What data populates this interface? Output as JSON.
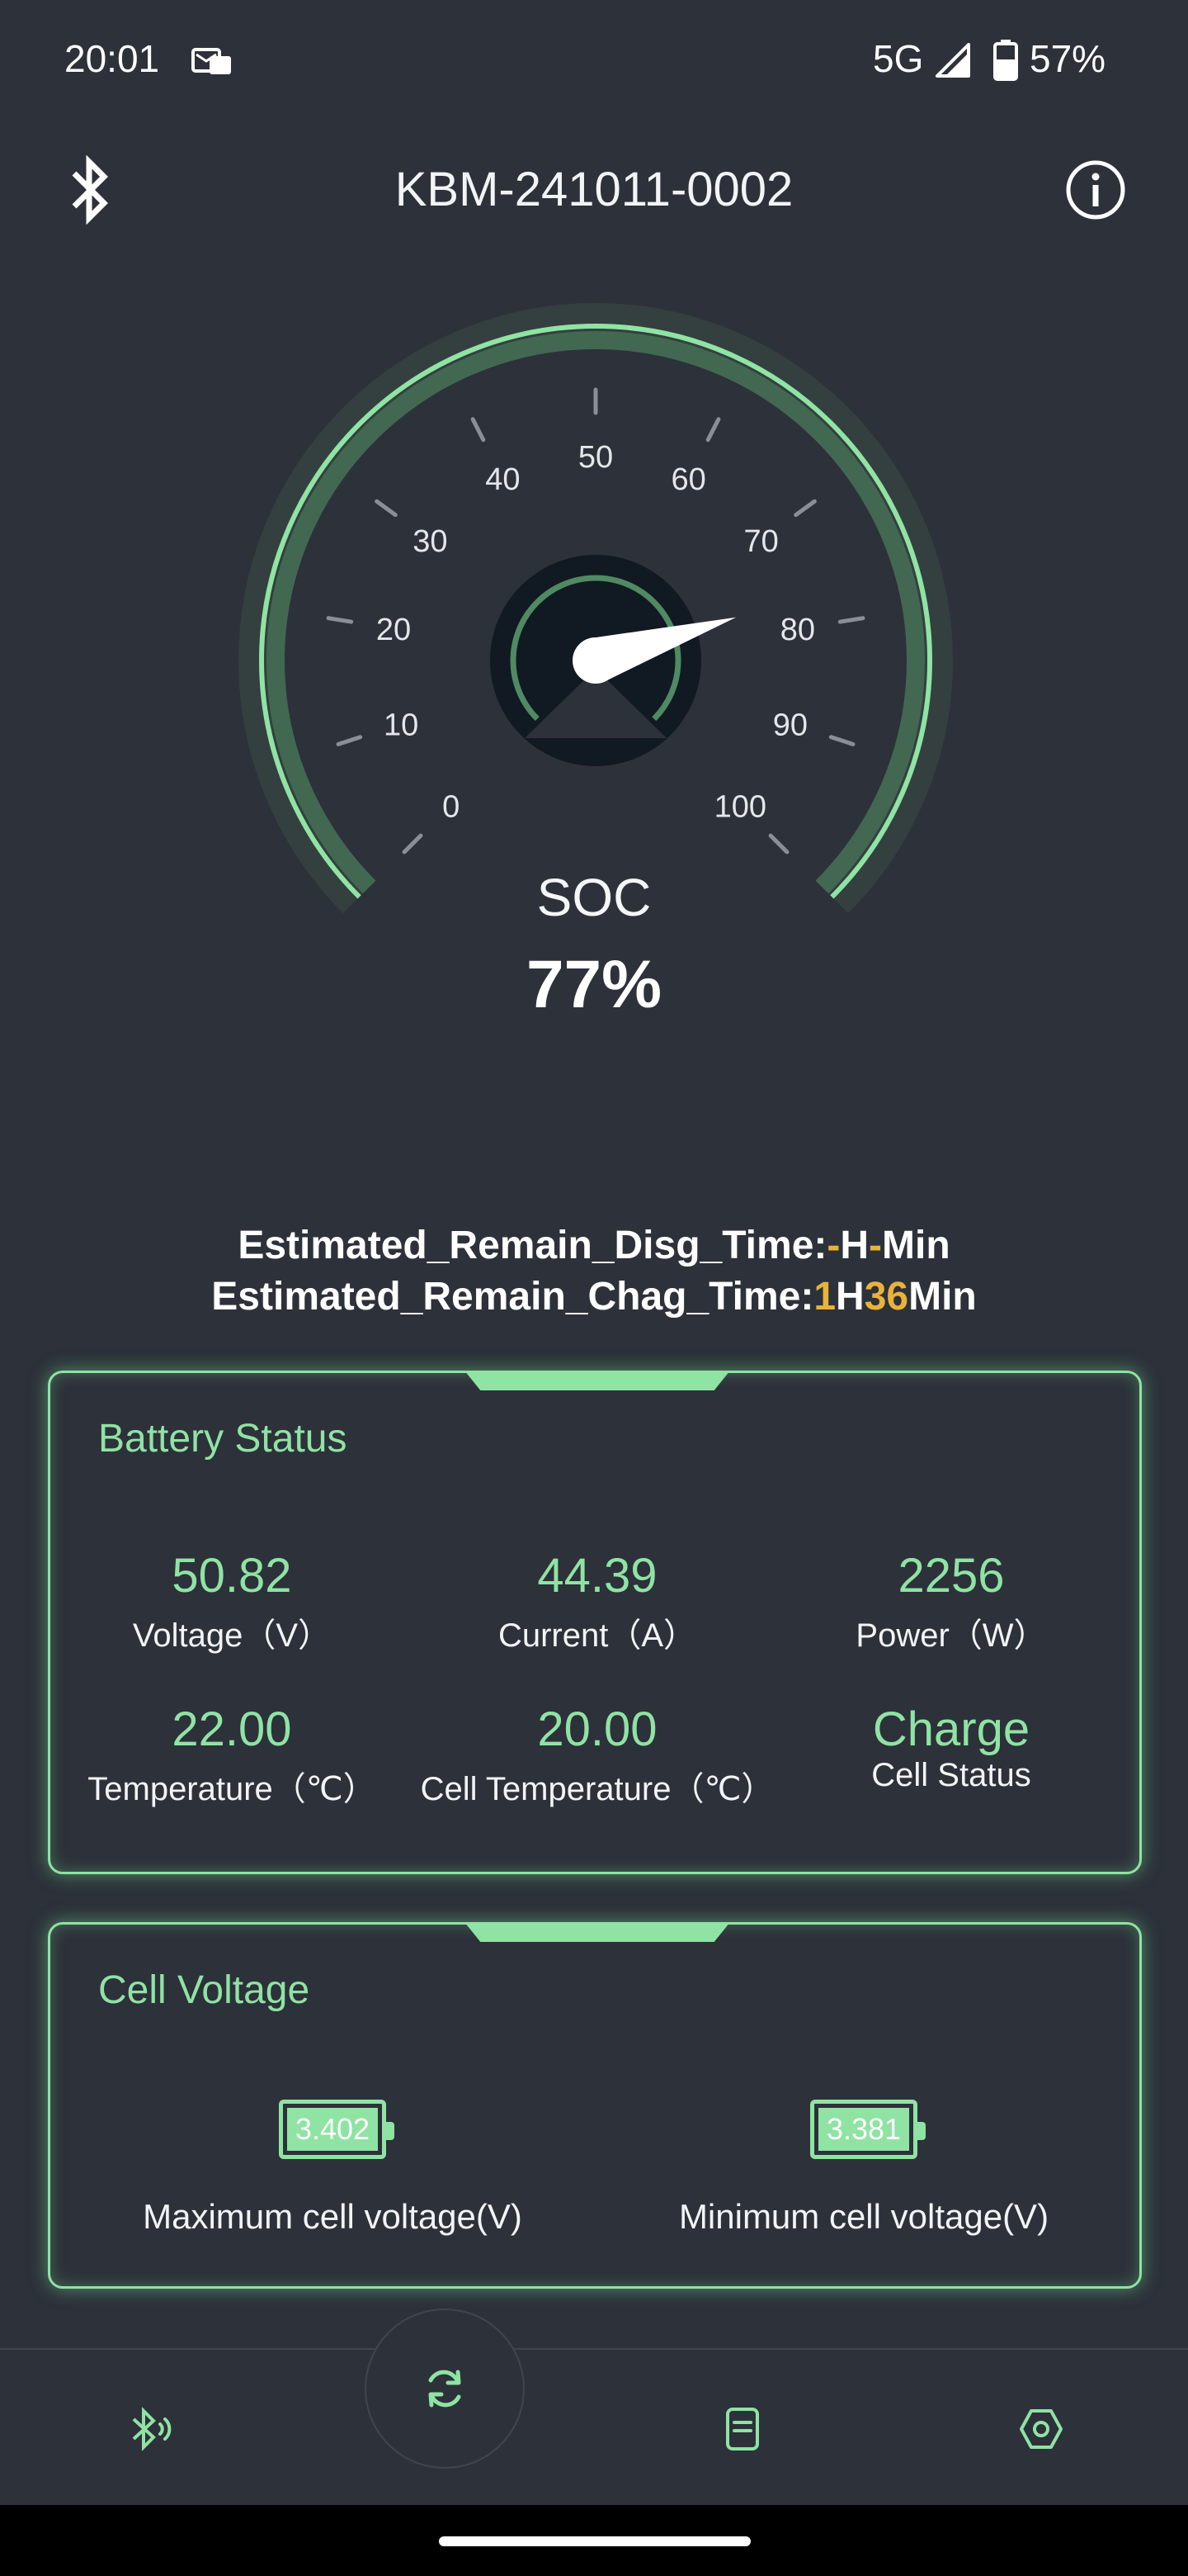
{
  "status_bar": {
    "time": "20:01",
    "network": "5G",
    "battery_pct": "57%",
    "icons": [
      "message-icon",
      "signal-icon",
      "battery-icon"
    ]
  },
  "header": {
    "title": "KBM-241011-0002",
    "left_icon": "bluetooth-icon",
    "right_icon": "info-icon"
  },
  "gauge": {
    "ticks": [
      "0",
      "10",
      "20",
      "30",
      "40",
      "50",
      "60",
      "70",
      "80",
      "90",
      "100"
    ],
    "value": 77,
    "min": 0,
    "max": 100,
    "label": "SOC",
    "value_text": "77%"
  },
  "estimates": {
    "disg_prefix": "Estimated_Remain_Disg_Time:",
    "disg_h": "-",
    "disg_h_unit": "H",
    "disg_m": "-",
    "disg_m_unit": "Min",
    "chag_prefix": "Estimated_Remain_Chag_Time:",
    "chag_h": "1",
    "chag_h_unit": "H",
    "chag_m": "36",
    "chag_m_unit": "Min"
  },
  "battery_status": {
    "title": "Battery Status",
    "metrics": [
      {
        "value": "50.82",
        "label": "Voltage（V）"
      },
      {
        "value": "44.39",
        "label": "Current（A）"
      },
      {
        "value": "2256",
        "label": "Power（W）"
      },
      {
        "value": "22.00",
        "label": "Temperature（℃）"
      },
      {
        "value": "20.00",
        "label": "Cell Temperature（℃）"
      },
      {
        "value": "Charge",
        "label": "Cell Status"
      }
    ]
  },
  "cell_voltage": {
    "title": "Cell Voltage",
    "max": {
      "value": "3.402",
      "label": "Maximum cell voltage(V)"
    },
    "min": {
      "value": "3.381",
      "label": "Minimum cell voltage(V)"
    }
  },
  "bottom_nav": {
    "items": [
      "bluetooth-device-icon",
      "refresh-icon",
      "document-icon",
      "settings-icon"
    ]
  },
  "colors": {
    "accent": "#8fe3a3",
    "background": "#2d313a",
    "highlight": "#e8b339"
  }
}
